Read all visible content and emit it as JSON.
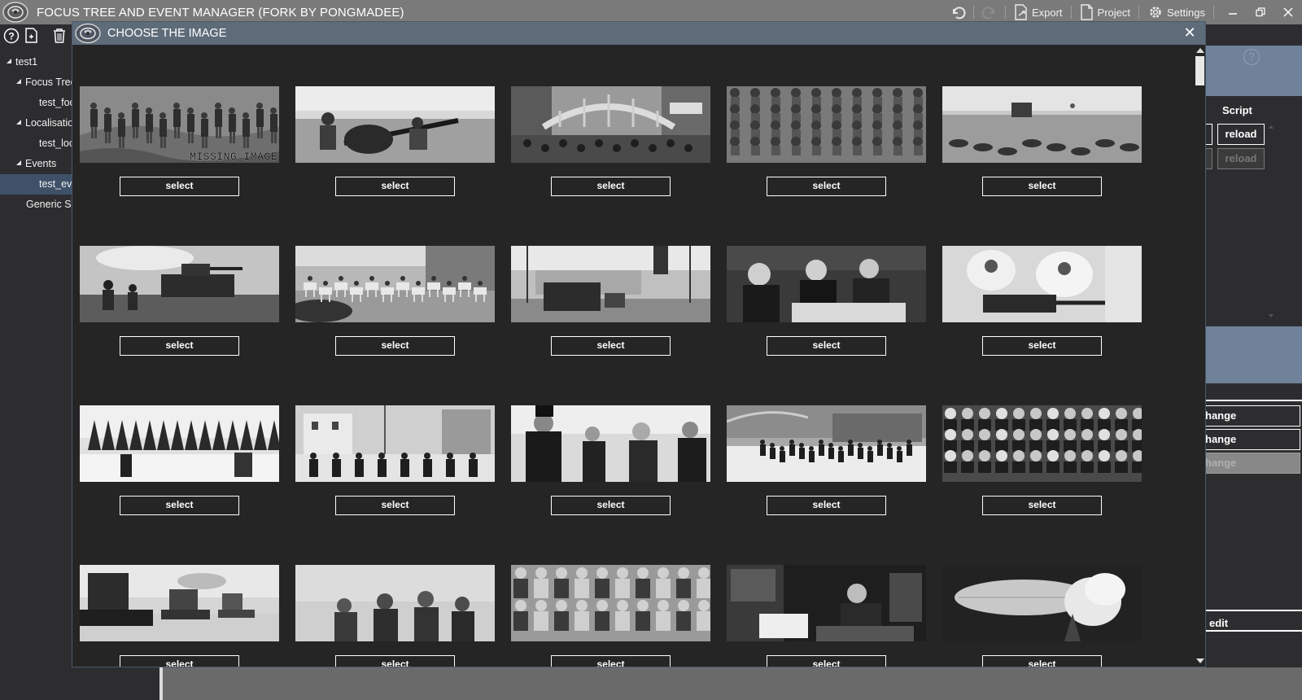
{
  "app": {
    "title": "FOCUS TREE AND EVENT MANAGER (FORK BY PONGMADEE)",
    "toolbar": {
      "export": "Export",
      "project": "Project",
      "settings": "Settings"
    }
  },
  "tree": {
    "items": [
      {
        "label": "test1",
        "level": 0,
        "expanded": true
      },
      {
        "label": "Focus Tree",
        "level": 1,
        "expanded": true
      },
      {
        "label": "test_foc",
        "level": 2
      },
      {
        "label": "Localisatio",
        "level": 1,
        "expanded": true
      },
      {
        "label": "test_loc",
        "level": 2
      },
      {
        "label": "Events",
        "level": 1,
        "expanded": true
      },
      {
        "label": "test_eve",
        "level": 2,
        "selected": true
      },
      {
        "label": "Generic Sc",
        "level": 1
      }
    ]
  },
  "right_panel": {
    "help": "?",
    "script_label": "Script",
    "reload": "reload",
    "reload_dim": "reload",
    "change1": "hange",
    "change2": "hange",
    "change3": "hange",
    "edit": "edit"
  },
  "dialog": {
    "title": "CHOOSE THE IMAGE",
    "close": "✕",
    "missing_label": "MISSING IMAGE",
    "select_label": "select",
    "images": [
      "missing-image",
      "artillery-crew",
      "city-bridge",
      "marching-soldiers",
      "field-soldiers",
      "tank-infantry",
      "cavalry-parade",
      "street-trucks",
      "officials-signing",
      "machine-gun-crew",
      "winter-forest",
      "town-soldiers",
      "diplomats-meeting",
      "village-march",
      "crowd",
      "battleships",
      "officers-group",
      "militia-group",
      "man-reading-newspaper",
      "airship-fire"
    ]
  }
}
